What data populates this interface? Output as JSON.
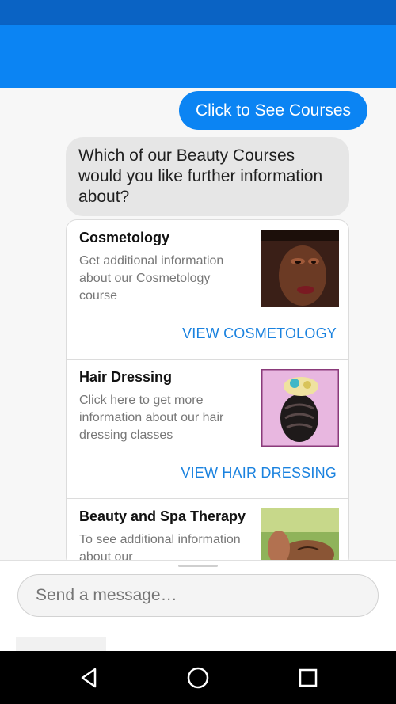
{
  "chat": {
    "user_message": "Click to See Courses",
    "bot_message": "Which of our Beauty Courses would you like further information about?"
  },
  "cards": [
    {
      "title": "Cosmetology",
      "description": "Get additional information about our Cosmetology course",
      "action": "VIEW COSMETOLOGY",
      "image_icon": "makeup-portrait-image"
    },
    {
      "title": "Hair Dressing",
      "description": "Click here to get more information about our hair dressing classes",
      "action": "VIEW HAIR DRESSING",
      "image_icon": "braided-hairstyle-image"
    },
    {
      "title": "Beauty and Spa Therapy",
      "description": "To see additional information about our",
      "action": "",
      "image_icon": "spa-massage-image"
    }
  ],
  "composer": {
    "placeholder": "Send a message…"
  },
  "nav": {
    "icons": [
      "back-icon",
      "home-icon",
      "recents-icon"
    ]
  },
  "colors": {
    "status_bar": "#0a63c4",
    "app_bar": "#0b84f3",
    "user_bubble": "#0b84f3",
    "action_text": "#1a82df"
  }
}
